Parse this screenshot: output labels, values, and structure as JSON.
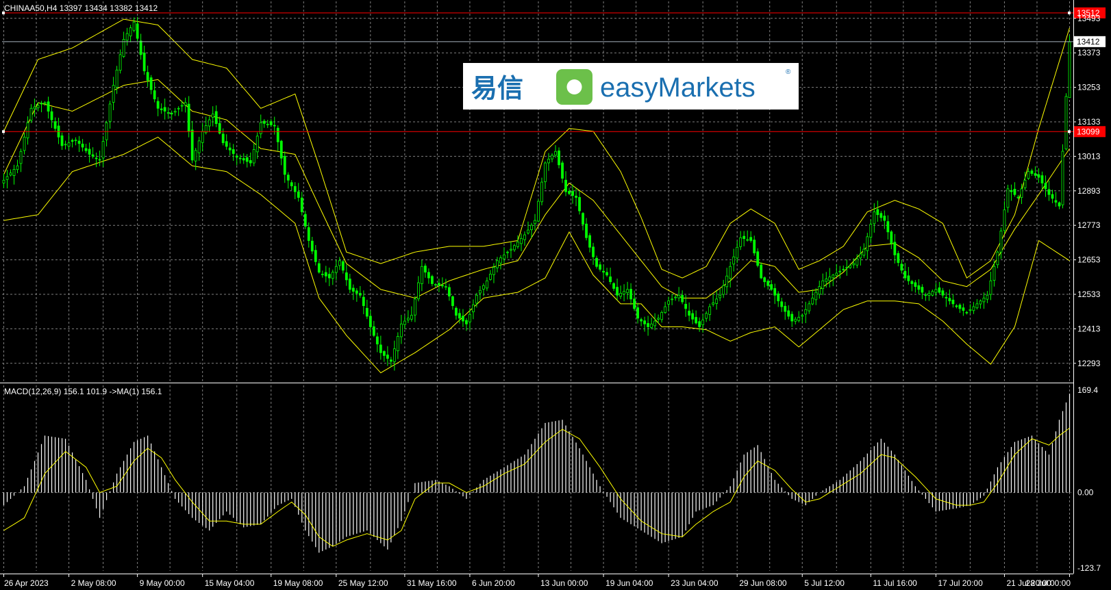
{
  "colors": {
    "background": "#000000",
    "grid": "#808080",
    "candle": "#00ff00",
    "bollinger": "#ffff00",
    "macd_histogram": "#ffffff",
    "macd_signal": "#ffff00",
    "level_line": "#ff0000",
    "current_price_line": "#a9b4c0",
    "logo_green": "#6cc04a",
    "logo_blue": "#1a6fb0",
    "axis_text": "#ffffff"
  },
  "chart_title": "CHINAA50,H4  13397 13434 13382 13412",
  "logo": {
    "chinese": "易信",
    "english": "easyMarkets",
    "registered": "®"
  },
  "chart_data": [
    {
      "type": "candlestick",
      "symbol": "CHINAA50",
      "timeframe": "H4",
      "ohlc_last": {
        "open": 13397,
        "high": 13434,
        "low": 13382,
        "close": 13412
      },
      "ylim": [
        12233,
        13533
      ],
      "y_ticks": [
        "13493",
        "13373",
        "13253",
        "13133",
        "13013",
        "12893",
        "12773",
        "12653",
        "12533",
        "12413",
        "12293"
      ],
      "x_ticks": [
        "26 Apr 2023",
        "2 May 08:00",
        "9 May 00:00",
        "15 May 04:00",
        "19 May 08:00",
        "25 May 12:00",
        "31 May 16:00",
        "6 Jun 20:00",
        "13 Jun 00:00",
        "19 Jun 04:00",
        "23 Jun 04:00",
        "29 Jun 08:00",
        "5 Jul 12:00",
        "11 Jul 16:00",
        "17 Jul 20:00",
        "21 Jul 20:00",
        "28 Jul 00:00"
      ],
      "price_path": [
        [
          0,
          12930
        ],
        [
          4,
          12980
        ],
        [
          8,
          13180
        ],
        [
          12,
          13200
        ],
        [
          17,
          13050
        ],
        [
          21,
          13070
        ],
        [
          25,
          13020
        ],
        [
          28,
          13000
        ],
        [
          32,
          13260
        ],
        [
          35,
          13420
        ],
        [
          38,
          13480
        ],
        [
          41,
          13310
        ],
        [
          45,
          13180
        ],
        [
          49,
          13160
        ],
        [
          53,
          13200
        ],
        [
          55,
          13000
        ],
        [
          58,
          13100
        ],
        [
          61,
          13160
        ],
        [
          64,
          13060
        ],
        [
          68,
          13010
        ],
        [
          72,
          12990
        ],
        [
          75,
          13130
        ],
        [
          79,
          13120
        ],
        [
          82,
          12950
        ],
        [
          86,
          12870
        ],
        [
          89,
          12720
        ],
        [
          92,
          12610
        ],
        [
          95,
          12590
        ],
        [
          98,
          12650
        ],
        [
          101,
          12550
        ],
        [
          104,
          12530
        ],
        [
          107,
          12420
        ],
        [
          110,
          12330
        ],
        [
          113,
          12300
        ],
        [
          116,
          12430
        ],
        [
          119,
          12460
        ],
        [
          122,
          12630
        ],
        [
          125,
          12570
        ],
        [
          129,
          12560
        ],
        [
          132,
          12460
        ],
        [
          135,
          12430
        ],
        [
          138,
          12530
        ],
        [
          141,
          12580
        ],
        [
          144,
          12650
        ],
        [
          148,
          12690
        ],
        [
          152,
          12740
        ],
        [
          155,
          12790
        ],
        [
          158,
          12990
        ],
        [
          161,
          13030
        ],
        [
          164,
          12890
        ],
        [
          167,
          12870
        ],
        [
          170,
          12730
        ],
        [
          173,
          12630
        ],
        [
          176,
          12600
        ],
        [
          179,
          12530
        ],
        [
          182,
          12550
        ],
        [
          185,
          12450
        ],
        [
          188,
          12420
        ],
        [
          191,
          12450
        ],
        [
          194,
          12510
        ],
        [
          197,
          12530
        ],
        [
          200,
          12460
        ],
        [
          203,
          12420
        ],
        [
          206,
          12490
        ],
        [
          209,
          12530
        ],
        [
          212,
          12630
        ],
        [
          215,
          12730
        ],
        [
          218,
          12720
        ],
        [
          221,
          12590
        ],
        [
          224,
          12550
        ],
        [
          227,
          12490
        ],
        [
          230,
          12440
        ],
        [
          233,
          12460
        ],
        [
          236,
          12520
        ],
        [
          239,
          12580
        ],
        [
          242,
          12600
        ],
        [
          245,
          12620
        ],
        [
          248,
          12640
        ],
        [
          251,
          12690
        ],
        [
          254,
          12820
        ],
        [
          257,
          12790
        ],
        [
          260,
          12670
        ],
        [
          263,
          12590
        ],
        [
          266,
          12560
        ],
        [
          269,
          12530
        ],
        [
          272,
          12550
        ],
        [
          275,
          12520
        ],
        [
          278,
          12490
        ],
        [
          281,
          12470
        ],
        [
          284,
          12500
        ],
        [
          287,
          12530
        ],
        [
          290,
          12680
        ],
        [
          293,
          12900
        ],
        [
          296,
          12870
        ],
        [
          299,
          12960
        ],
        [
          302,
          12940
        ],
        [
          305,
          12880
        ],
        [
          308,
          12840
        ],
        [
          311,
          13412
        ]
      ],
      "bb_upper": [
        [
          0,
          13100
        ],
        [
          10,
          13350
        ],
        [
          20,
          13390
        ],
        [
          35,
          13490
        ],
        [
          45,
          13470
        ],
        [
          55,
          13350
        ],
        [
          65,
          13320
        ],
        [
          75,
          13180
        ],
        [
          85,
          13230
        ],
        [
          92,
          12980
        ],
        [
          100,
          12680
        ],
        [
          110,
          12640
        ],
        [
          120,
          12680
        ],
        [
          130,
          12700
        ],
        [
          140,
          12700
        ],
        [
          150,
          12720
        ],
        [
          158,
          13030
        ],
        [
          165,
          13110
        ],
        [
          172,
          13100
        ],
        [
          180,
          12960
        ],
        [
          186,
          12800
        ],
        [
          192,
          12620
        ],
        [
          198,
          12590
        ],
        [
          205,
          12630
        ],
        [
          212,
          12780
        ],
        [
          218,
          12830
        ],
        [
          225,
          12780
        ],
        [
          232,
          12620
        ],
        [
          238,
          12650
        ],
        [
          245,
          12700
        ],
        [
          252,
          12820
        ],
        [
          260,
          12860
        ],
        [
          267,
          12830
        ],
        [
          274,
          12780
        ],
        [
          281,
          12590
        ],
        [
          288,
          12650
        ],
        [
          295,
          12810
        ],
        [
          302,
          13110
        ],
        [
          311,
          13460
        ]
      ],
      "bb_middle": [
        [
          0,
          12950
        ],
        [
          10,
          13200
        ],
        [
          20,
          13170
        ],
        [
          35,
          13260
        ],
        [
          45,
          13280
        ],
        [
          55,
          13170
        ],
        [
          65,
          13140
        ],
        [
          75,
          13040
        ],
        [
          85,
          13020
        ],
        [
          92,
          12840
        ],
        [
          100,
          12640
        ],
        [
          110,
          12550
        ],
        [
          120,
          12520
        ],
        [
          130,
          12580
        ],
        [
          140,
          12620
        ],
        [
          150,
          12650
        ],
        [
          158,
          12810
        ],
        [
          165,
          12920
        ],
        [
          172,
          12860
        ],
        [
          180,
          12740
        ],
        [
          186,
          12650
        ],
        [
          192,
          12560
        ],
        [
          198,
          12520
        ],
        [
          205,
          12520
        ],
        [
          212,
          12580
        ],
        [
          218,
          12650
        ],
        [
          225,
          12630
        ],
        [
          232,
          12540
        ],
        [
          238,
          12550
        ],
        [
          245,
          12610
        ],
        [
          252,
          12700
        ],
        [
          260,
          12710
        ],
        [
          267,
          12660
        ],
        [
          274,
          12580
        ],
        [
          281,
          12560
        ],
        [
          288,
          12620
        ],
        [
          295,
          12760
        ],
        [
          302,
          12880
        ],
        [
          311,
          13040
        ]
      ],
      "bb_lower": [
        [
          0,
          12790
        ],
        [
          10,
          12810
        ],
        [
          20,
          12960
        ],
        [
          35,
          13020
        ],
        [
          45,
          13080
        ],
        [
          55,
          12980
        ],
        [
          65,
          12960
        ],
        [
          75,
          12880
        ],
        [
          85,
          12780
        ],
        [
          92,
          12520
        ],
        [
          100,
          12390
        ],
        [
          110,
          12260
        ],
        [
          120,
          12330
        ],
        [
          130,
          12410
        ],
        [
          140,
          12520
        ],
        [
          150,
          12540
        ],
        [
          158,
          12590
        ],
        [
          165,
          12750
        ],
        [
          172,
          12600
        ],
        [
          180,
          12500
        ],
        [
          186,
          12500
        ],
        [
          192,
          12420
        ],
        [
          198,
          12420
        ],
        [
          205,
          12410
        ],
        [
          212,
          12370
        ],
        [
          218,
          12400
        ],
        [
          225,
          12420
        ],
        [
          232,
          12350
        ],
        [
          238,
          12410
        ],
        [
          245,
          12480
        ],
        [
          252,
          12510
        ],
        [
          260,
          12510
        ],
        [
          267,
          12500
        ],
        [
          274,
          12440
        ],
        [
          281,
          12360
        ],
        [
          288,
          12290
        ],
        [
          295,
          12420
        ],
        [
          302,
          12720
        ],
        [
          311,
          12650
        ]
      ],
      "levels": [
        {
          "label": "13512",
          "price": 13512
        },
        {
          "label": "13099",
          "price": 13099
        }
      ],
      "current_price": {
        "label": "13412",
        "price": 13412
      }
    },
    {
      "type": "macd",
      "legend": "MACD(12,26,9) 156.1 101.9  ->MA(1) 156.1",
      "ylim": [
        -123.7,
        169.4
      ],
      "y_ticks": [
        "169.4",
        "0.00",
        "-123.7"
      ],
      "histogram_path": [
        [
          0,
          -20
        ],
        [
          6,
          10
        ],
        [
          12,
          90
        ],
        [
          18,
          85
        ],
        [
          24,
          20
        ],
        [
          28,
          -40
        ],
        [
          33,
          30
        ],
        [
          38,
          80
        ],
        [
          42,
          90
        ],
        [
          46,
          40
        ],
        [
          50,
          -10
        ],
        [
          55,
          -40
        ],
        [
          60,
          -60
        ],
        [
          65,
          -30
        ],
        [
          70,
          -55
        ],
        [
          75,
          -50
        ],
        [
          80,
          -20
        ],
        [
          84,
          -10
        ],
        [
          88,
          -60
        ],
        [
          92,
          -95
        ],
        [
          96,
          -85
        ],
        [
          100,
          -70
        ],
        [
          106,
          -60
        ],
        [
          112,
          -90
        ],
        [
          116,
          -45
        ],
        [
          120,
          15
        ],
        [
          126,
          20
        ],
        [
          130,
          10
        ],
        [
          135,
          -10
        ],
        [
          140,
          20
        ],
        [
          146,
          40
        ],
        [
          152,
          60
        ],
        [
          158,
          110
        ],
        [
          163,
          115
        ],
        [
          168,
          70
        ],
        [
          174,
          10
        ],
        [
          180,
          -40
        ],
        [
          186,
          -60
        ],
        [
          192,
          -80
        ],
        [
          198,
          -70
        ],
        [
          202,
          -30
        ],
        [
          207,
          -20
        ],
        [
          212,
          10
        ],
        [
          216,
          60
        ],
        [
          220,
          75
        ],
        [
          225,
          20
        ],
        [
          230,
          -10
        ],
        [
          234,
          -20
        ],
        [
          238,
          0
        ],
        [
          244,
          20
        ],
        [
          250,
          50
        ],
        [
          256,
          85
        ],
        [
          260,
          60
        ],
        [
          266,
          10
        ],
        [
          272,
          -30
        ],
        [
          278,
          -25
        ],
        [
          282,
          -20
        ],
        [
          286,
          -5
        ],
        [
          290,
          40
        ],
        [
          295,
          80
        ],
        [
          300,
          90
        ],
        [
          305,
          60
        ],
        [
          308,
          115
        ],
        [
          311,
          156.1
        ]
      ],
      "signal_path": [
        [
          0,
          -60
        ],
        [
          6,
          -40
        ],
        [
          12,
          30
        ],
        [
          18,
          65
        ],
        [
          24,
          40
        ],
        [
          28,
          0
        ],
        [
          33,
          10
        ],
        [
          38,
          50
        ],
        [
          42,
          70
        ],
        [
          46,
          55
        ],
        [
          50,
          20
        ],
        [
          55,
          -15
        ],
        [
          60,
          -45
        ],
        [
          65,
          -45
        ],
        [
          70,
          -50
        ],
        [
          75,
          -50
        ],
        [
          80,
          -30
        ],
        [
          84,
          -15
        ],
        [
          88,
          -35
        ],
        [
          92,
          -70
        ],
        [
          96,
          -85
        ],
        [
          100,
          -75
        ],
        [
          106,
          -65
        ],
        [
          112,
          -75
        ],
        [
          116,
          -60
        ],
        [
          120,
          -10
        ],
        [
          126,
          15
        ],
        [
          130,
          15
        ],
        [
          135,
          0
        ],
        [
          140,
          10
        ],
        [
          146,
          30
        ],
        [
          152,
          45
        ],
        [
          158,
          80
        ],
        [
          163,
          100
        ],
        [
          168,
          85
        ],
        [
          174,
          40
        ],
        [
          180,
          -10
        ],
        [
          186,
          -45
        ],
        [
          192,
          -65
        ],
        [
          198,
          -70
        ],
        [
          202,
          -50
        ],
        [
          207,
          -30
        ],
        [
          212,
          -15
        ],
        [
          216,
          25
        ],
        [
          220,
          50
        ],
        [
          225,
          35
        ],
        [
          230,
          5
        ],
        [
          234,
          -15
        ],
        [
          238,
          -10
        ],
        [
          244,
          10
        ],
        [
          250,
          30
        ],
        [
          256,
          60
        ],
        [
          260,
          55
        ],
        [
          266,
          25
        ],
        [
          272,
          -10
        ],
        [
          278,
          -20
        ],
        [
          282,
          -20
        ],
        [
          286,
          -15
        ],
        [
          290,
          15
        ],
        [
          295,
          60
        ],
        [
          300,
          85
        ],
        [
          305,
          75
        ],
        [
          308,
          90
        ],
        [
          311,
          101.9
        ]
      ]
    }
  ]
}
